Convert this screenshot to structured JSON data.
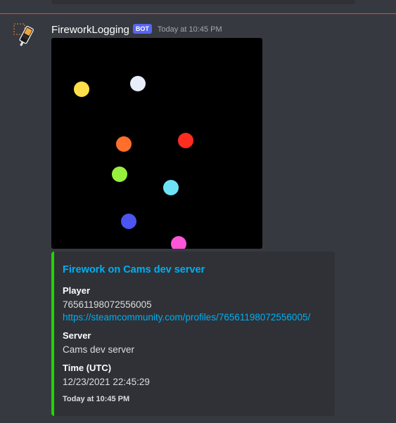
{
  "message": {
    "username": "FireworkLogging",
    "bot_tag": "BOT",
    "timestamp": "Today at 10:45 PM",
    "avatar_icon": "firework-rocket-icon"
  },
  "attachment": {
    "background": "#000000",
    "particles": [
      {
        "color": "#ffe04a",
        "name": "yellow"
      },
      {
        "color": "#e9eefb",
        "name": "white"
      },
      {
        "color": "#ff6f2b",
        "name": "orange"
      },
      {
        "color": "#ff2c20",
        "name": "red"
      },
      {
        "color": "#97f03e",
        "name": "green"
      },
      {
        "color": "#6ee3f7",
        "name": "cyan"
      },
      {
        "color": "#4c55f0",
        "name": "blue"
      },
      {
        "color": "#ff55d8",
        "name": "pink"
      }
    ]
  },
  "embed": {
    "accent_color": "#23d401",
    "title": "Firework on Cams dev server",
    "fields": {
      "player": {
        "name": "Player",
        "value": "76561198072556005",
        "link": "https://steamcommunity.com/profiles/76561198072556005/"
      },
      "server": {
        "name": "Server",
        "value": "Cams dev server"
      },
      "time": {
        "name": "Time (UTC)",
        "value": "12/23/2021 22:45:29"
      }
    },
    "footer": "Today at 10:45 PM"
  },
  "colors": {
    "background": "#36393f",
    "embed_background": "#2f3136",
    "new_messages_divider": "#ed4245",
    "link": "#00aff4",
    "bot_tag": "#5865f2"
  }
}
